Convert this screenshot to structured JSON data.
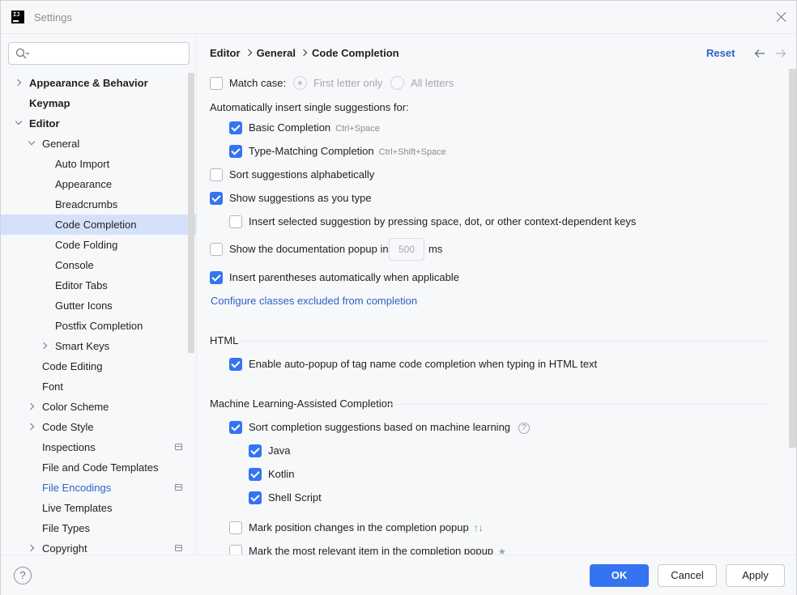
{
  "window": {
    "title": "Settings"
  },
  "search": {
    "placeholder": ""
  },
  "sidebar": {
    "items": [
      {
        "label": "Appearance & Behavior"
      },
      {
        "label": "Keymap"
      },
      {
        "label": "Editor"
      },
      {
        "label": "General"
      },
      {
        "label": "Auto Import"
      },
      {
        "label": "Appearance"
      },
      {
        "label": "Breadcrumbs"
      },
      {
        "label": "Code Completion"
      },
      {
        "label": "Code Folding"
      },
      {
        "label": "Console"
      },
      {
        "label": "Editor Tabs"
      },
      {
        "label": "Gutter Icons"
      },
      {
        "label": "Postfix Completion"
      },
      {
        "label": "Smart Keys"
      },
      {
        "label": "Code Editing"
      },
      {
        "label": "Font"
      },
      {
        "label": "Color Scheme"
      },
      {
        "label": "Code Style"
      },
      {
        "label": "Inspections"
      },
      {
        "label": "File and Code Templates"
      },
      {
        "label": "File Encodings"
      },
      {
        "label": "Live Templates"
      },
      {
        "label": "File Types"
      },
      {
        "label": "Copyright"
      }
    ]
  },
  "header": {
    "breadcrumb": [
      "Editor",
      "General",
      "Code Completion"
    ],
    "reset_label": "Reset"
  },
  "main": {
    "match_case": {
      "label": "Match case:",
      "checked": false,
      "opt1": "First letter only",
      "opt2": "All letters"
    },
    "auto_insert_heading": "Automatically insert single suggestions for:",
    "basic_completion": {
      "label": "Basic Completion",
      "shortcut": "Ctrl+Space",
      "checked": true
    },
    "type_matching": {
      "label": "Type-Matching Completion",
      "shortcut": "Ctrl+Shift+Space",
      "checked": true
    },
    "sort_alpha": {
      "label": "Sort suggestions alphabetically",
      "checked": false
    },
    "show_as_type": {
      "label": "Show suggestions as you type",
      "checked": true
    },
    "insert_selected": {
      "label": "Insert selected suggestion by pressing space, dot, or other context-dependent keys",
      "checked": false
    },
    "doc_popup": {
      "label": "Show the documentation popup in",
      "value": "500",
      "unit": "ms",
      "checked": false
    },
    "insert_parens": {
      "label": "Insert parentheses automatically when applicable",
      "checked": true
    },
    "configure_link": "Configure classes excluded from completion",
    "html_section": "HTML",
    "html_autopopup": {
      "label": "Enable auto-popup of tag name code completion when typing in HTML text",
      "checked": true
    },
    "ml_section": "Machine Learning-Assisted Completion",
    "ml_sort": {
      "label": "Sort completion suggestions based on machine learning",
      "checked": true
    },
    "ml_java": {
      "label": "Java",
      "checked": true
    },
    "ml_kotlin": {
      "label": "Kotlin",
      "checked": true
    },
    "ml_shell": {
      "label": "Shell Script",
      "checked": true
    },
    "mark_position": {
      "label": "Mark position changes in the completion popup",
      "checked": false
    },
    "mark_relevant": {
      "label": "Mark the most relevant item in the completion popup",
      "checked": false
    }
  },
  "footer": {
    "help_label": "?",
    "ok_label": "OK",
    "cancel_label": "Cancel",
    "apply_label": "Apply"
  },
  "colors": {
    "accent": "#3574f0",
    "link": "#2f62c9",
    "selection": "#d5e1fb"
  }
}
